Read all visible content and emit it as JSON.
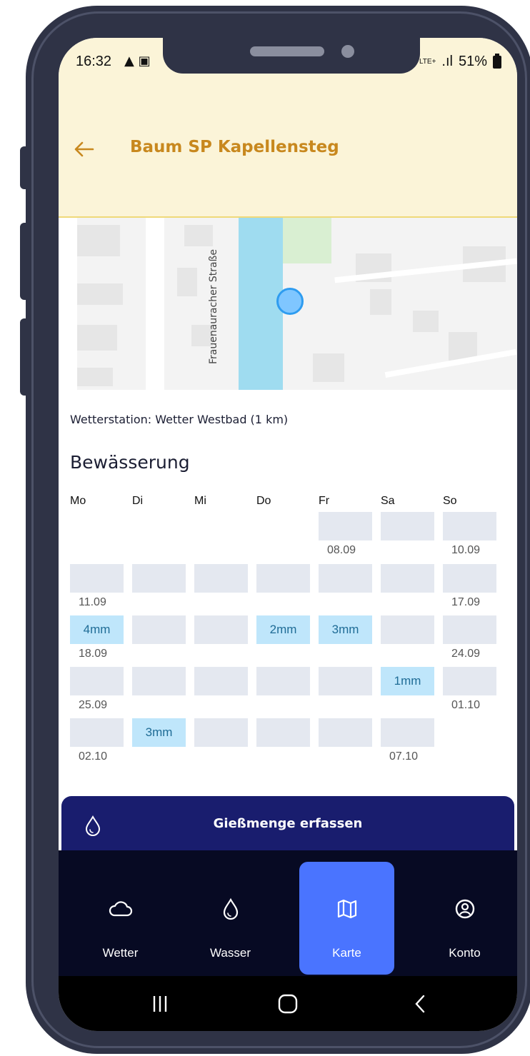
{
  "status_bar": {
    "time": "16:32",
    "network": "LTE+",
    "battery": "51%"
  },
  "header": {
    "title": "Baum SP Kapellensteg"
  },
  "map": {
    "street_label": "Frauenauracher Straße"
  },
  "weather_station": "Wetterstation: Wetter Westbad (1 km)",
  "watering": {
    "title": "Bewässerung",
    "days": [
      "Mo",
      "Di",
      "Mi",
      "Do",
      "Fr",
      "Sa",
      "So"
    ],
    "weeks": [
      {
        "cells": [
          "",
          "",
          "",
          "",
          "",
          "",
          ""
        ],
        "blank_before": 4,
        "dates": {
          "4": "08.09",
          "6": "10.09"
        }
      },
      {
        "cells": [
          "",
          "",
          "",
          "",
          "",
          "",
          ""
        ],
        "dates": {
          "0": "11.09",
          "6": "17.09"
        }
      },
      {
        "cells": [
          "4mm",
          "",
          "",
          "2mm",
          "3mm",
          "",
          ""
        ],
        "dates": {
          "0": "18.09",
          "6": "24.09"
        }
      },
      {
        "cells": [
          "",
          "",
          "",
          "",
          "",
          "1mm",
          ""
        ],
        "dates": {
          "0": "25.09",
          "6": "01.10"
        }
      },
      {
        "cells": [
          "",
          "3mm",
          "",
          "",
          "",
          "",
          null
        ],
        "dates": {
          "0": "02.10",
          "5": "07.10"
        }
      }
    ]
  },
  "action_button": {
    "label": "Gießmenge erfassen"
  },
  "bottom_nav": [
    {
      "label": "Wetter",
      "icon": "cloud-icon",
      "active": false
    },
    {
      "label": "Wasser",
      "icon": "water-drop-icon",
      "active": false
    },
    {
      "label": "Karte",
      "icon": "map-icon",
      "active": true
    },
    {
      "label": "Konto",
      "icon": "account-icon",
      "active": false
    }
  ],
  "colors": {
    "header_bg": "#fbf4d8",
    "title": "#c8881e",
    "primary_dark": "#191d6e",
    "nav_bg": "#070a23",
    "nav_active": "#4a74ff",
    "water_cell": "#bfe6fb"
  }
}
